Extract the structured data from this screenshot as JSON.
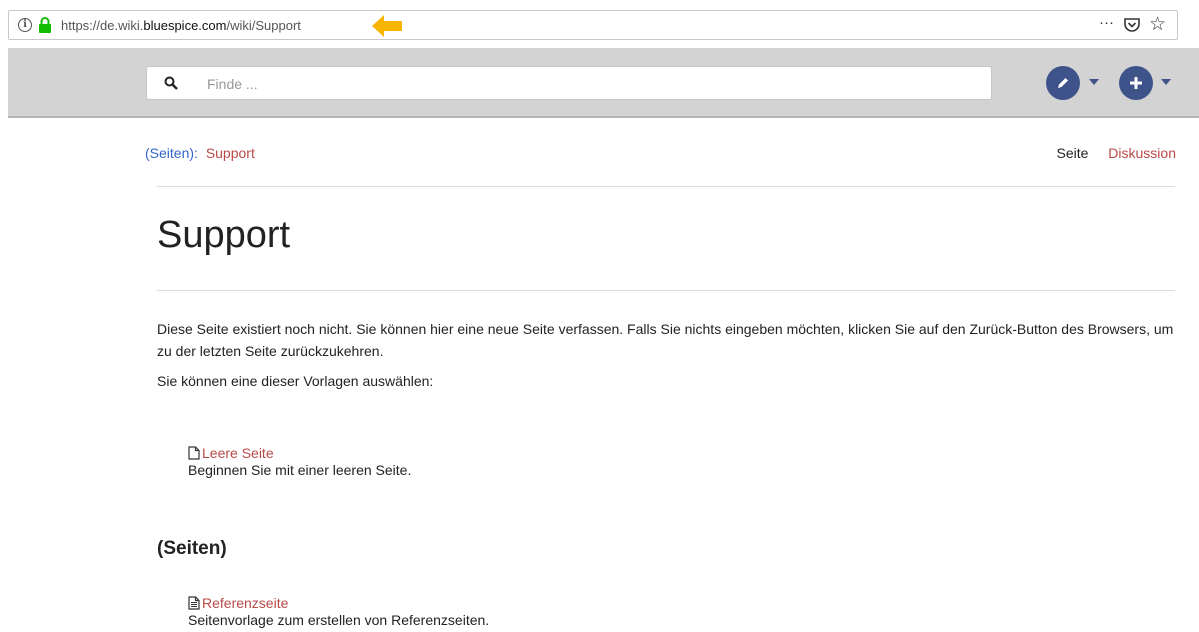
{
  "browser": {
    "url_prefix": "https://de.wiki.",
    "url_domain": "bluespice.com",
    "url_path": "/wiki/Support",
    "more_label": "···",
    "star_label": "☆",
    "info_label": "i"
  },
  "header": {
    "search_placeholder": "Finde ..."
  },
  "breadcrumb": {
    "root": "(Seiten)",
    "separator": ":",
    "page": "Support"
  },
  "tabs": {
    "page": "Seite",
    "discussion": "Diskussion"
  },
  "content": {
    "title": "Support",
    "intro": "Diese Seite existiert noch nicht. Sie können hier eine neue Seite verfassen. Falls Sie nichts eingeben möchten, klicken Sie auf den Zurück-Button des Browsers, um zu der letzten Seite zurückzukehren.",
    "choose_template": "Sie können eine dieser Vorlagen auswählen:",
    "templates": [
      {
        "label": "Leere Seite",
        "description": "Beginnen Sie mit einer leeren Seite."
      }
    ],
    "section": "(Seiten)",
    "section_templates": [
      {
        "label": "Referenzseite",
        "description": "Seitenvorlage zum erstellen von Referenzseiten."
      }
    ]
  },
  "colors": {
    "link_red": "#b94a48",
    "link_blue": "#3366cc",
    "button_blue": "#3e5389",
    "arrow_yellow": "#f7b500",
    "lock_green": "#12bc00"
  }
}
